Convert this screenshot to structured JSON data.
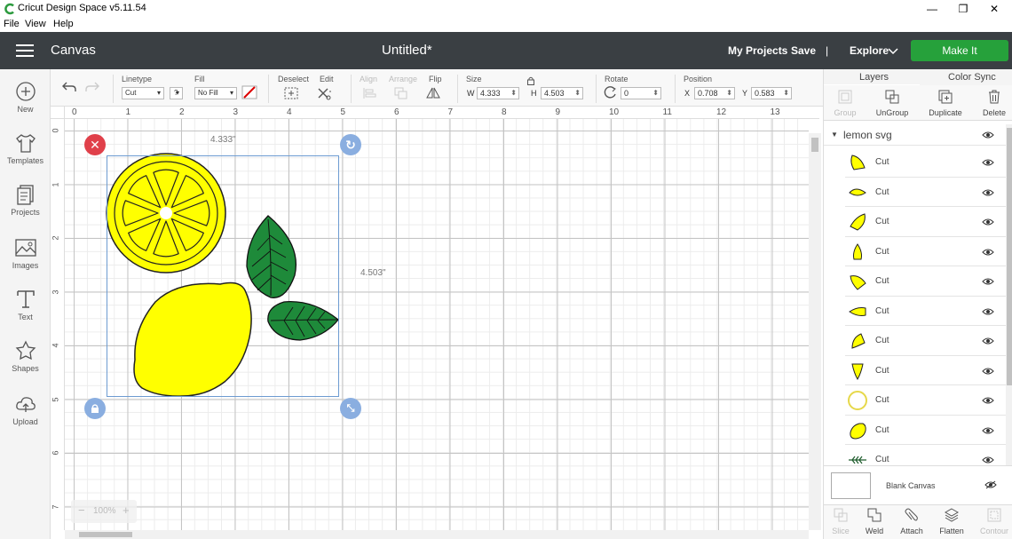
{
  "window": {
    "title": "Cricut Design Space  v5.11.54",
    "controls": {
      "minimize": "—",
      "maximize": "❐",
      "close": "✕"
    }
  },
  "menu": [
    "File",
    "View",
    "Help"
  ],
  "header": {
    "section": "Canvas",
    "document_title": "Untitled*",
    "my_projects": "My Projects",
    "save": "Save",
    "separator": "|",
    "machine": "Explore",
    "make_it": "Make It"
  },
  "sidebar": {
    "items": [
      {
        "label": "New",
        "icon": "plus-circle-icon"
      },
      {
        "label": "Templates",
        "icon": "shirt-icon"
      },
      {
        "label": "Projects",
        "icon": "projects-icon"
      },
      {
        "label": "Images",
        "icon": "image-icon"
      },
      {
        "label": "Text",
        "icon": "text-icon"
      },
      {
        "label": "Shapes",
        "icon": "shapes-icon"
      },
      {
        "label": "Upload",
        "icon": "upload-cloud-icon"
      }
    ]
  },
  "toolbar": {
    "linetype_label": "Linetype",
    "linetype_value": "Cut",
    "linetype_help": "?",
    "fill_label": "Fill",
    "fill_value": "No Fill",
    "deselect_label": "Deselect",
    "edit_label": "Edit",
    "align_label": "Align",
    "arrange_label": "Arrange",
    "flip_label": "Flip",
    "size_label": "Size",
    "w_prefix": "W",
    "w_value": "4.333",
    "h_prefix": "H",
    "h_value": "4.503",
    "rotate_label": "Rotate",
    "rotate_value": "0",
    "position_label": "Position",
    "x_prefix": "X",
    "x_value": "0.708",
    "y_prefix": "Y",
    "y_value": "0.583"
  },
  "ruler": {
    "top": [
      "0",
      "1",
      "2",
      "3",
      "4",
      "5",
      "6",
      "7",
      "8",
      "9",
      "10",
      "11",
      "12",
      "13"
    ],
    "left": [
      "0",
      "1",
      "2",
      "3",
      "4",
      "5",
      "6",
      "7"
    ]
  },
  "canvas": {
    "width_dim": "4.333\"",
    "height_dim": "4.503\"",
    "zoom_minus": "−",
    "zoom_level": "100%",
    "zoom_plus": "+",
    "colors": {
      "lemon": "#ffff00",
      "leaf": "#1e8a3a",
      "selection": "#6d9bd1",
      "delete_handle": "#e0404a",
      "handle": "#8aaee0"
    }
  },
  "layers_panel": {
    "tabs": [
      "Layers",
      "Color Sync"
    ],
    "tools": [
      {
        "label": "Group",
        "icon": "group-icon",
        "enabled": false
      },
      {
        "label": "UnGroup",
        "icon": "ungroup-icon",
        "enabled": true
      },
      {
        "label": "Duplicate",
        "icon": "duplicate-icon",
        "enabled": true
      },
      {
        "label": "Delete",
        "icon": "trash-icon",
        "enabled": true
      }
    ],
    "group_name": "lemon svg",
    "layers": [
      {
        "name": "Cut",
        "shape": "segment-a"
      },
      {
        "name": "Cut",
        "shape": "segment-b"
      },
      {
        "name": "Cut",
        "shape": "segment-c"
      },
      {
        "name": "Cut",
        "shape": "segment-d"
      },
      {
        "name": "Cut",
        "shape": "segment-e"
      },
      {
        "name": "Cut",
        "shape": "segment-f"
      },
      {
        "name": "Cut",
        "shape": "segment-g"
      },
      {
        "name": "Cut",
        "shape": "segment-h"
      },
      {
        "name": "Cut",
        "shape": "ring"
      },
      {
        "name": "Cut",
        "shape": "lemon"
      },
      {
        "name": "Cut",
        "shape": "leaf-veins"
      }
    ],
    "blank_canvas": "Blank Canvas",
    "bottom_tools": [
      {
        "label": "Slice",
        "enabled": false
      },
      {
        "label": "Weld",
        "enabled": true
      },
      {
        "label": "Attach",
        "enabled": true
      },
      {
        "label": "Flatten",
        "enabled": true
      },
      {
        "label": "Contour",
        "enabled": false
      }
    ]
  }
}
